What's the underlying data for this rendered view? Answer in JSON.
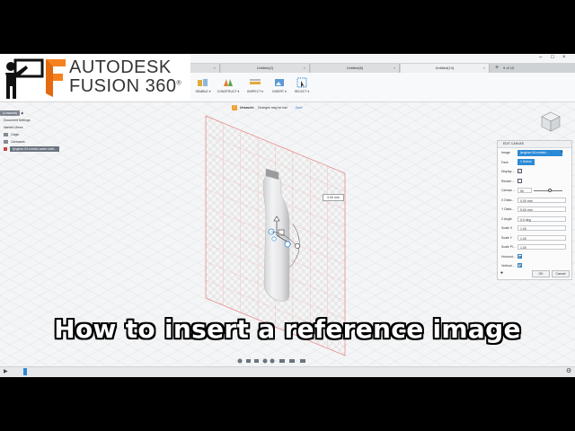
{
  "brand": {
    "line1": "AUTODESK",
    "line2": "FUSION 360",
    "registered": "®"
  },
  "caption": "How to insert a reference image",
  "tabs": [
    {
      "label": "Untitled(1)"
    },
    {
      "label": "Untitled(2)"
    },
    {
      "label": "Untitled(6)"
    },
    {
      "label": "Untitled(14)"
    }
  ],
  "page_count": "9 of 10",
  "toolbar": {
    "assemble": "SEMBLE ▾",
    "construct": "CONSTRUCT ▾",
    "inspect": "INSPECT ▾",
    "insert": "INSERT ▾",
    "select": "SELECT ▾"
  },
  "warning": {
    "label": "Unsaved:",
    "message": "Changes may be lost",
    "save": "Save"
  },
  "browser": {
    "root": "(Unsaved)",
    "items": [
      "Document Settings",
      "Named Views",
      "Origin",
      "Canvases"
    ],
    "canvas_item": "lynghse-04-metalx-water-bottl..."
  },
  "dimension": "0.00 mm",
  "panel": {
    "title": "EDIT CANVAS",
    "rows": [
      {
        "label": "Image",
        "value": "lynghse-04-metalx..."
      },
      {
        "label": "Face",
        "value": "1 Select"
      },
      {
        "label": "Display ...",
        "value": ""
      },
      {
        "label": "Render ...",
        "value": ""
      },
      {
        "label": "Canvas ...",
        "value": "50"
      },
      {
        "label": "X Dista...",
        "value": "0.00 mm"
      },
      {
        "label": "Y Dista...",
        "value": "5.50 mm"
      },
      {
        "label": "Z Angle",
        "value": "0.0 deg"
      },
      {
        "label": "Scale X",
        "value": "1.00"
      },
      {
        "label": "Scale Y",
        "value": "1.00"
      },
      {
        "label": "Scale Pl...",
        "value": "1.00"
      },
      {
        "label": "Horizont...",
        "value": ""
      },
      {
        "label": "Vertical ...",
        "value": ""
      }
    ],
    "ok": "OK",
    "cancel": "Cancel",
    "slider_level": 0.55
  },
  "colors": {
    "accent": "#2b8ad6",
    "warning": "#f0a030",
    "brand_orange": "#f58220",
    "canvas_line": "#e87a7a"
  }
}
